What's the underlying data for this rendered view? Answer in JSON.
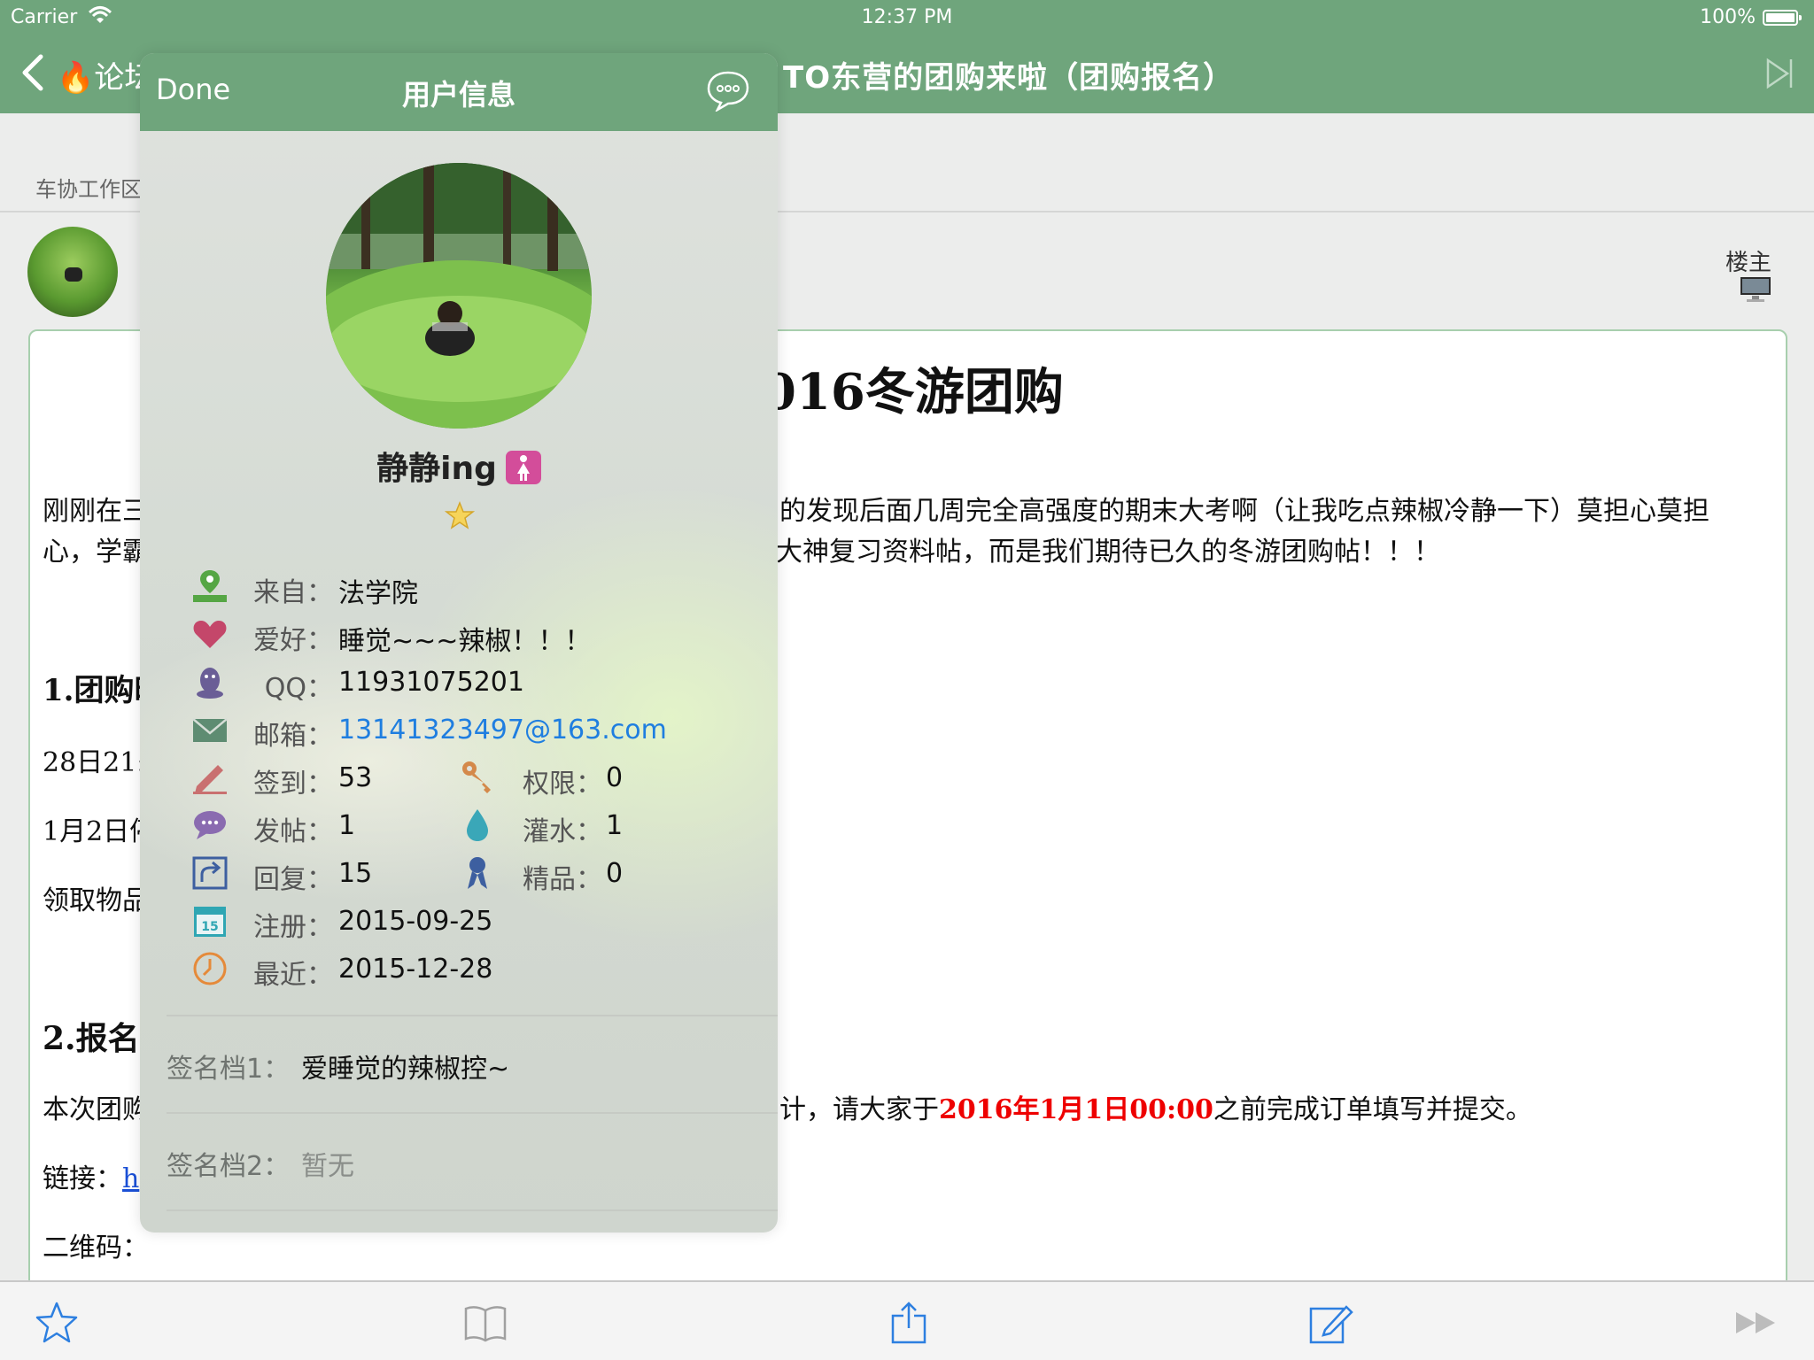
{
  "status": {
    "carrier": "Carrier",
    "time": "12:37 PM",
    "battery": "100%"
  },
  "nav": {
    "back_label": "🔥论坛",
    "title": "TO东营的团购来啦（团购报名）"
  },
  "post": {
    "breadcrumb": "车协工作区",
    "floor_label": "楼主",
    "heading": "016冬游团购",
    "p1a": "刚刚在三",
    "p1b": "心，学霸",
    "p1a_r": "的发现后面几周完全高强度的期末大考啊（让我吃点辣椒冷静一下）莫担心莫担",
    "p1b_r": "大神复习资料帖，而是我们期待已久的冬游团购帖！！！",
    "s1": "1.团购时",
    "l1": "28日21:0",
    "l2": "1月2日停",
    "l3": "领取物品",
    "s2": "2.报名",
    "l4": "本次团购",
    "l4_r_a": "计，请大家于",
    "l4_r_b": "2016年1月1日00:00",
    "l4_r_c": "之前完成订单填写并提交。",
    "l5": "链接：",
    "l5_link": "h",
    "l6": "二维码："
  },
  "popover": {
    "done": "Done",
    "title": "用户信息",
    "username": "静静ing",
    "rows": {
      "from": {
        "label": "来自：",
        "value": "法学院"
      },
      "hobby": {
        "label": "爱好：",
        "value": "睡觉~~~辣椒！！！"
      },
      "qq": {
        "label": "QQ：",
        "value": "11931075201"
      },
      "email": {
        "label": "邮箱：",
        "value": "13141323497@163.com"
      },
      "checkin": {
        "label": "签到：",
        "value": "53"
      },
      "perm": {
        "label": "权限：",
        "value": "0"
      },
      "posts": {
        "label": "发帖：",
        "value": "1"
      },
      "water": {
        "label": "灌水：",
        "value": "1"
      },
      "replies": {
        "label": "回复：",
        "value": "15"
      },
      "elite": {
        "label": "精品：",
        "value": "0"
      },
      "register": {
        "label": "注册：",
        "value": "2015-09-25"
      },
      "recent": {
        "label": "最近：",
        "value": "2015-12-28"
      }
    },
    "sig1_label": "签名档1：",
    "sig1_value": "爱睡觉的辣椒控~",
    "sig2_label": "签名档2：",
    "sig2_value": "暂无"
  },
  "colors": {
    "accent": "#6fa57c",
    "link": "#1f7ee0",
    "deadline": "#e00000"
  },
  "icons": {
    "toolbar": [
      "star-icon",
      "book-icon",
      "share-icon",
      "compose-icon",
      "fast-forward-icon"
    ],
    "rows": [
      "location-pin-icon",
      "heart-icon",
      "qq-penguin-icon",
      "envelope-icon",
      "pencil-icon",
      "key-icon",
      "speech-bubble-icon",
      "water-drop-icon",
      "reply-arrow-icon",
      "ribbon-icon",
      "calendar-icon",
      "clock-icon"
    ]
  }
}
